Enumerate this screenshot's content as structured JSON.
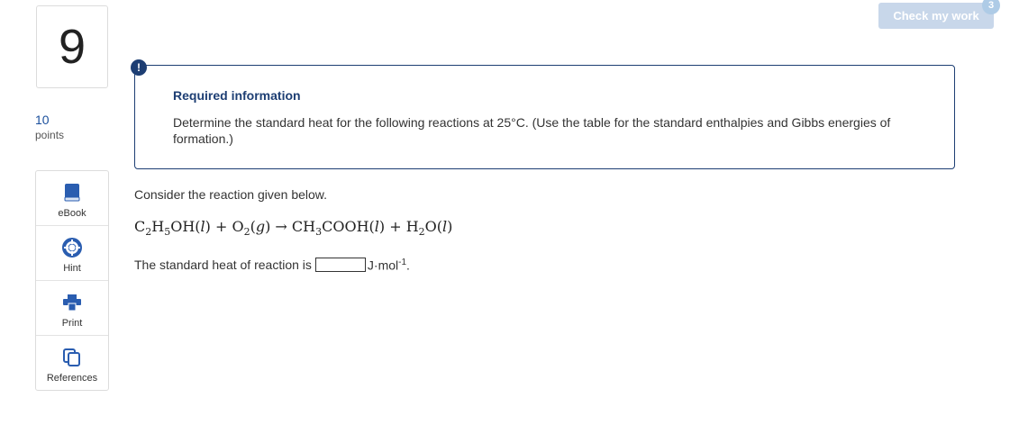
{
  "question": {
    "number": "9",
    "points_value": "10",
    "points_label": "points"
  },
  "tools": [
    {
      "label": "eBook",
      "icon": "book-icon"
    },
    {
      "label": "Hint",
      "icon": "lifebuoy-icon"
    },
    {
      "label": "Print",
      "icon": "printer-icon"
    },
    {
      "label": "References",
      "icon": "copy-icon"
    }
  ],
  "header": {
    "check_label": "Check my work",
    "badge_count": "3"
  },
  "info": {
    "alert_symbol": "!",
    "title": "Required information",
    "text": "Determine the standard heat for the following reactions at 25°C. (Use the table for the standard enthalpies and Gibbs energies of formation.)"
  },
  "body": {
    "consider": "Consider the reaction given below.",
    "answer_prefix": "The standard heat of reaction is",
    "answer_value": "",
    "unit": "J·mol",
    "unit_exp": "-1",
    "unit_suffix": "."
  },
  "colors": {
    "accent": "#1d3e73",
    "button_disabled": "#c8d7ea",
    "icon_blue": "#2a5db0"
  }
}
